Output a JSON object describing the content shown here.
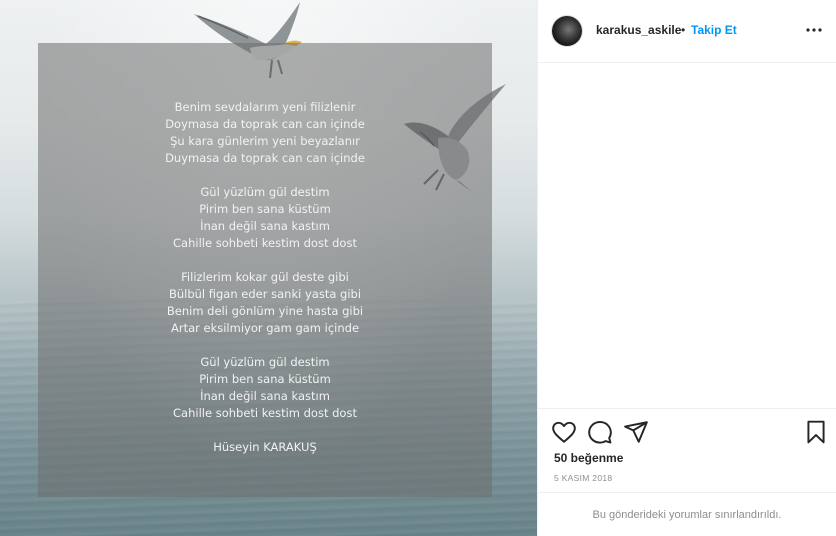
{
  "post": {
    "username": "karakus_askile",
    "separator": "•",
    "follow_label": "Takip Et",
    "likes": "50 beğenme",
    "date": "5 KASIM 2018",
    "comments_disabled": "Bu gönderideki yorumlar sınırlandırıldı."
  },
  "poem": {
    "stanzas": [
      [
        "Benim sevdalarım yeni filizlenir",
        "Doymasa da toprak can can içinde",
        "Şu kara günlerim yeni beyazlanır",
        "Duymasa da toprak can can içinde"
      ],
      [
        "Gül yüzlüm gül destim",
        "Pirim ben sana küstüm",
        "İnan değil sana kastım",
        "Cahille sohbeti kestim dost dost"
      ],
      [
        "Filizlerim kokar gül deste gibi",
        "Bülbül figan eder sanki yasta gibi",
        "Benim deli gönlüm yine hasta gibi",
        "Artar eksilmiyor gam gam içinde"
      ],
      [
        "Gül yüzlüm gül destim",
        "Pirim ben sana küstüm",
        "İnan değil sana kastım",
        "Cahille sohbeti kestim dost dost"
      ]
    ],
    "author": "Hüseyin KARAKUŞ"
  },
  "icons": {
    "more": "more-options-icon",
    "like": "heart-icon",
    "comment": "comment-icon",
    "share": "share-icon",
    "save": "bookmark-icon"
  },
  "colors": {
    "follow": "#0095f6",
    "text": "#262626",
    "muted": "#8e8e8e"
  }
}
